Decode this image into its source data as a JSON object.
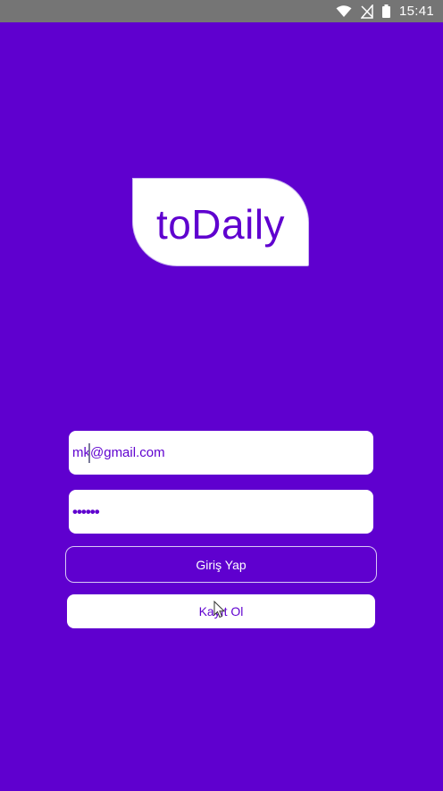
{
  "status_bar": {
    "time": "15:41",
    "icons": [
      "wifi-icon",
      "no-signal-icon",
      "battery-icon"
    ]
  },
  "logo": {
    "text": "toDaily"
  },
  "login_form": {
    "email_value": "mk@gmail.com",
    "password_value": "••••••",
    "login_label": "Giriş Yap",
    "register_label": "Kayıt Ol"
  },
  "colors": {
    "brand_purple": "#5f00cf",
    "status_bar_gray": "#757575",
    "white": "#ffffff"
  }
}
